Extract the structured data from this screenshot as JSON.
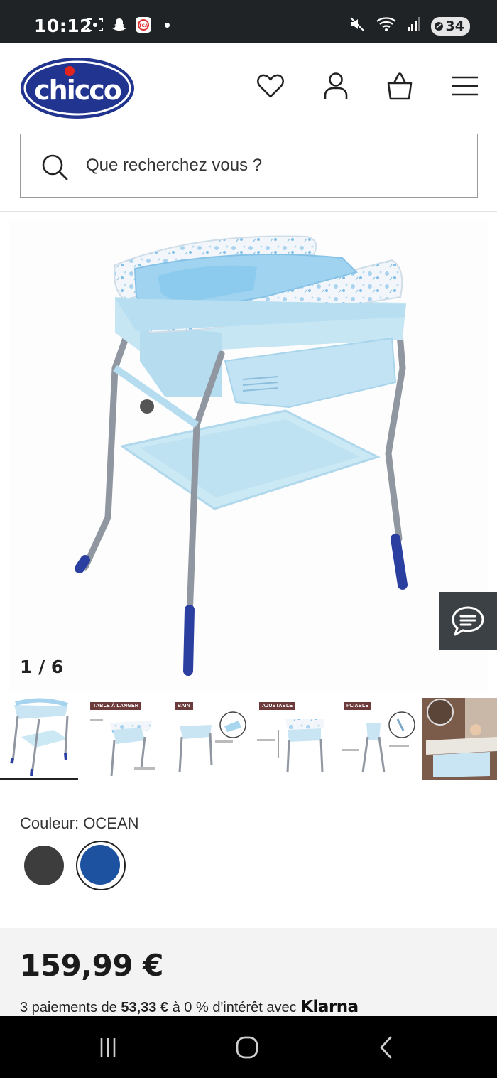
{
  "status_bar": {
    "time": "10:12",
    "battery": "34"
  },
  "header": {
    "logo_text": "chicco",
    "brand_color": "#21348f",
    "search_placeholder": "Que recherchez vous ?"
  },
  "gallery": {
    "counter": "1 / 6",
    "thumbnails": [
      {
        "tag": ""
      },
      {
        "tag": "TABLE À LANGER"
      },
      {
        "tag": "BAIN"
      },
      {
        "tag": "AJUSTABLE"
      },
      {
        "tag": "PLIABLE"
      },
      {
        "tag": ""
      }
    ]
  },
  "product": {
    "color_label": "Couleur: OCEAN",
    "colors": [
      {
        "name": "dark-grey",
        "hex": "#3d3d3d"
      },
      {
        "name": "ocean",
        "hex": "#1c52a0",
        "selected": true
      }
    ],
    "price": "159,99 €",
    "klarna_prefix": "3 paiements de ",
    "klarna_amount": "53,33 €",
    "klarna_middle": " à 0 % d'intérêt avec ",
    "klarna_brand": "Klarna"
  }
}
